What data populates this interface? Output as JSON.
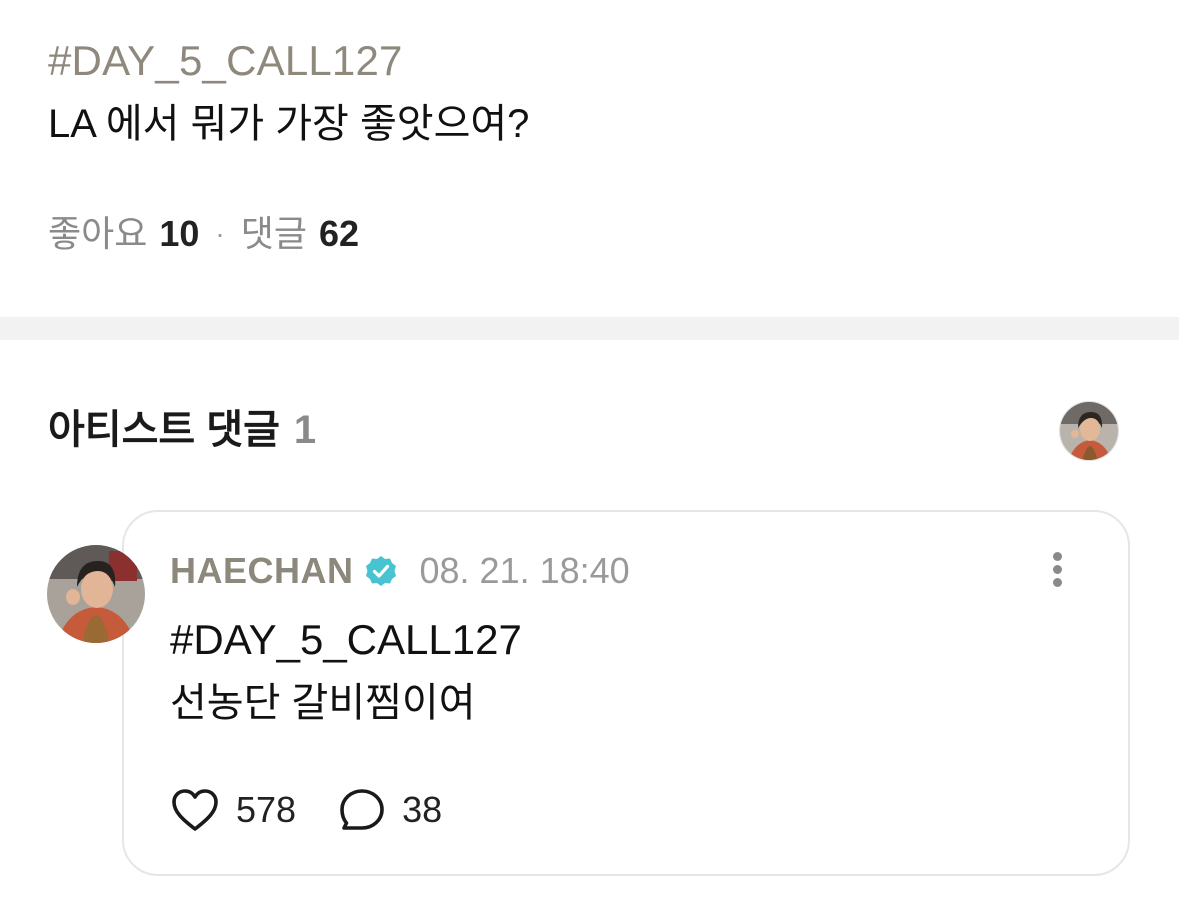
{
  "post": {
    "hashtag": "#DAY_5_CALL127",
    "question": "LA 에서 뭐가 가장 좋앗으여?",
    "likes_label": "좋아요",
    "likes_count": "10",
    "separator": "·",
    "comments_label": "댓글",
    "comments_count": "62"
  },
  "artist_section": {
    "title": "아티스트 댓글",
    "count": "1"
  },
  "comment": {
    "author": "HAECHAN",
    "timestamp": "08. 21. 18:40",
    "hashtag": "#DAY_5_CALL127",
    "text": "선농단 갈비찜이여",
    "likes": "578",
    "replies": "38"
  },
  "icons": {
    "verified": "verified-badge-icon",
    "more": "more-vertical-icon",
    "like": "heart-outline-icon",
    "reply": "speech-bubble-icon"
  },
  "colors": {
    "hashtag": "#8f897d",
    "author": "#8d887c",
    "verified": "#49c3cf",
    "muted": "#8a8a8a",
    "divider": "#f2f2f2"
  }
}
